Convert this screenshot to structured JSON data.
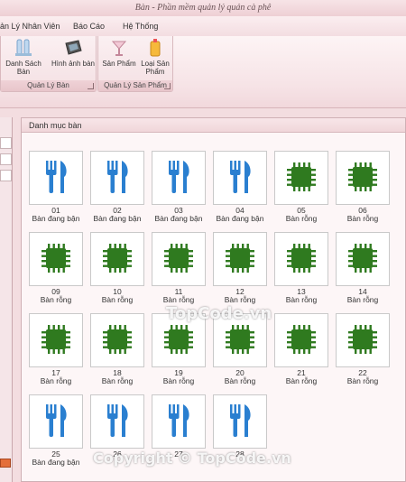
{
  "window": {
    "title": "Bàn - Phần mềm quản lý quán cà phê"
  },
  "menu": {
    "items": [
      "ản Lý Nhân Viên",
      "Báo Cáo",
      "Hệ Thống"
    ]
  },
  "ribbon": {
    "groups": [
      {
        "label": "Quản Lý Bàn",
        "buttons": [
          "Danh Sách Bàn",
          "Hình ảnh bàn"
        ]
      },
      {
        "label": "Quản Lý Sản Phẩm",
        "buttons": [
          "Sản Phẩm",
          "Loại Sản",
          "Phẩm"
        ]
      }
    ]
  },
  "panel": {
    "title": "Danh mục bàn"
  },
  "colors": {
    "occupied": "#2a7fd0",
    "empty": "#2f7a1f"
  },
  "tables": [
    {
      "num": "01",
      "status": "Bàn đang bận",
      "icon": "fork-knife-icon"
    },
    {
      "num": "02",
      "status": "Bàn đang bận",
      "icon": "fork-knife-icon"
    },
    {
      "num": "03",
      "status": "Bàn đang bận",
      "icon": "fork-knife-icon"
    },
    {
      "num": "04",
      "status": "Bàn đang bận",
      "icon": "fork-knife-icon"
    },
    {
      "num": "05",
      "status": "Bàn rỗng",
      "icon": "chip-icon"
    },
    {
      "num": "06",
      "status": "Bàn rỗng",
      "icon": "chip-icon"
    },
    {
      "num": "09",
      "status": "Bàn rỗng",
      "icon": "chip-icon"
    },
    {
      "num": "10",
      "status": "Bàn rỗng",
      "icon": "chip-icon"
    },
    {
      "num": "11",
      "status": "Bàn rỗng",
      "icon": "chip-icon"
    },
    {
      "num": "12",
      "status": "Bàn rỗng",
      "icon": "chip-icon"
    },
    {
      "num": "13",
      "status": "Bàn rỗng",
      "icon": "chip-icon"
    },
    {
      "num": "14",
      "status": "Bàn rỗng",
      "icon": "chip-icon"
    },
    {
      "num": "17",
      "status": "Bàn rỗng",
      "icon": "chip-icon"
    },
    {
      "num": "18",
      "status": "Bàn rỗng",
      "icon": "chip-icon"
    },
    {
      "num": "19",
      "status": "Bàn rỗng",
      "icon": "chip-icon"
    },
    {
      "num": "20",
      "status": "Bàn rỗng",
      "icon": "chip-icon"
    },
    {
      "num": "21",
      "status": "Bàn rỗng",
      "icon": "chip-icon"
    },
    {
      "num": "22",
      "status": "Bàn rỗng",
      "icon": "chip-icon"
    },
    {
      "num": "25",
      "status": "Bàn đang bận",
      "icon": "fork-knife-icon"
    },
    {
      "num": "26",
      "status": "",
      "icon": "fork-knife-icon"
    },
    {
      "num": "27",
      "status": "",
      "icon": "fork-knife-icon"
    },
    {
      "num": "28",
      "status": "",
      "icon": "fork-knife-icon"
    }
  ],
  "watermarks": [
    "TopCode.vn",
    "Copyright © TopCode.vn"
  ]
}
